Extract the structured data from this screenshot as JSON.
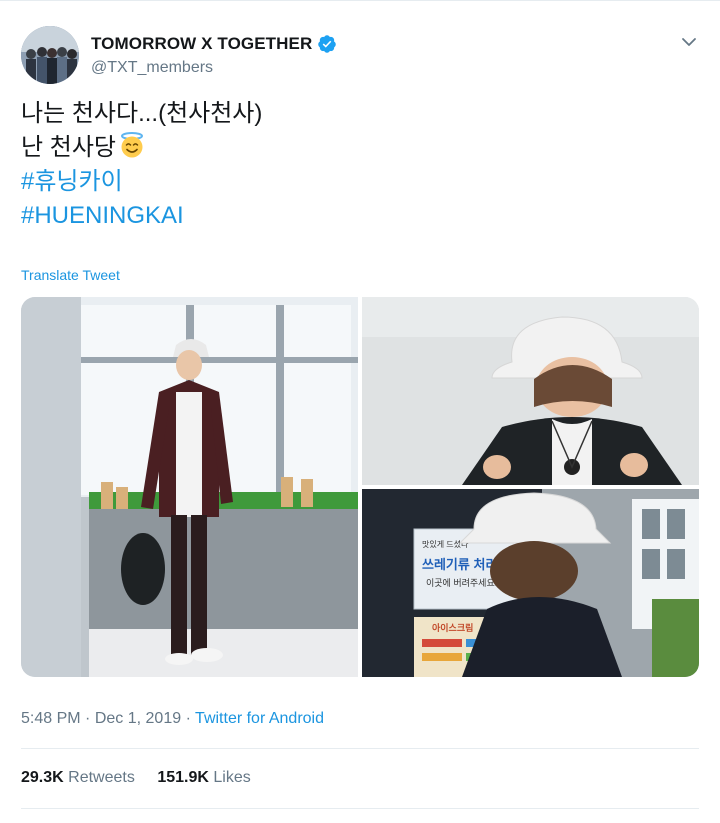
{
  "tweet": {
    "display_name": "TOMORROW X TOGETHER",
    "handle": "@TXT_members",
    "lines": [
      "나는 천사다...(천사천사)",
      "난 천사당"
    ],
    "hashtags": [
      "#휴닝카이",
      "#HUENINGKAI"
    ],
    "emoji_icon": "smiling-face-with-halo",
    "translate_label": "Translate Tweet",
    "time": "5:48 PM",
    "date": "Dec 1, 2019",
    "dot": "·",
    "source": "Twitter for Android",
    "retweets_count": "29.3K",
    "retweets_label": "Retweets",
    "likes_count": "151.9K",
    "likes_label": "Likes"
  },
  "colors": {
    "link": "#1b95e0",
    "verified": "#1da1f2",
    "muted": "#657786"
  },
  "media": {
    "photos": [
      {
        "description": "standing-full-body-photo"
      },
      {
        "description": "bucket-hat-closeup-photo"
      },
      {
        "description": "back-view-photo"
      }
    ],
    "sign_text": {
      "sign_small": "맛있게 드셨다",
      "sign_main": "쓰레기류 처리",
      "sign_sub": "이곳에 버려주세요!",
      "poster_title": "아이스크림"
    }
  }
}
